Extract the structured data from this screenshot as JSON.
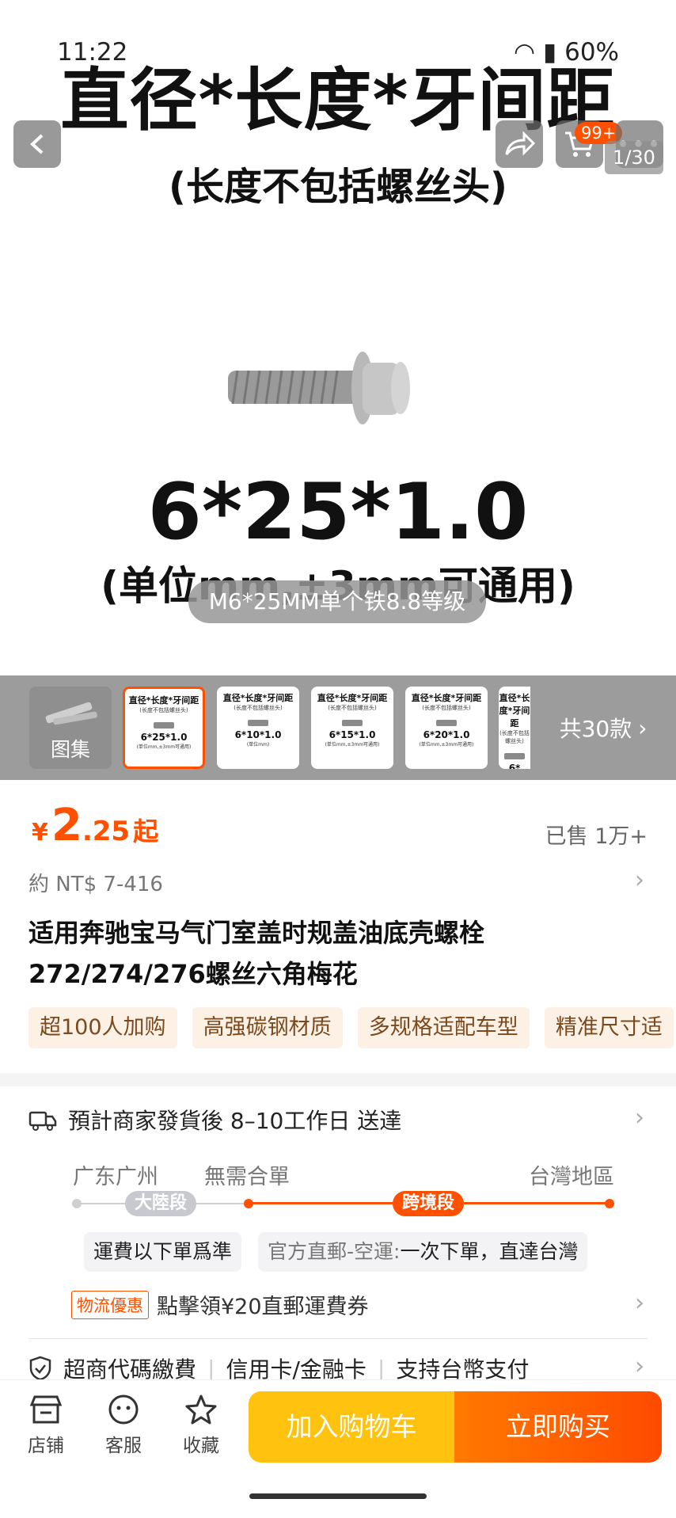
{
  "status_bar": {
    "time": "11:22",
    "battery": "60%"
  },
  "hero": {
    "title": "直径*长度*牙间距",
    "subtitle": "(长度不包括螺丝头)",
    "size": "6*25*1.0",
    "unit": "(单位mm,±3mm可通用)",
    "caption": "M6*25MM单个铁8.8等级",
    "cart_badge": "99+",
    "counter": "1/30"
  },
  "thumbnails": {
    "gallery_label": "图集",
    "title": "直径*长度*牙间距",
    "sub": "(长度不包括螺丝头)",
    "items": [
      {
        "value": "6*25*1.0",
        "unit": "(单位mm,±3mm可通用)"
      },
      {
        "value": "6*10*1.0",
        "unit": "(单位mm)"
      },
      {
        "value": "6*15*1.0",
        "unit": "(单位mm,±3mm可通用)"
      },
      {
        "value": "6*20*1.0",
        "unit": "(单位mm,±3mm可通用)"
      },
      {
        "value": "6*",
        "unit": ""
      }
    ],
    "more_label": "共30款"
  },
  "product": {
    "price_symbol": "¥",
    "price_int": "2",
    "price_dec": ".25",
    "price_suffix": "起",
    "sold": "已售 1万+",
    "approx": "約 NT$ 7-416",
    "title_line1": "适用奔驰宝马气门室盖时规盖油底壳螺栓",
    "title_line2": "272/274/276螺丝六角梅花",
    "tags": [
      "超100人加购",
      "高强碳钢材质",
      "多规格适配车型",
      "精准尺寸适"
    ]
  },
  "delivery": {
    "estimate": "預計商家發貨後 8–10工作日 送達",
    "origin": "广东广州",
    "consolidation": "無需合單",
    "destination": "台灣地區",
    "segment_mainland": "大陸段",
    "segment_cross": "跨境段",
    "note_left": "運費以下單爲準",
    "note_right_label": "官方直郵-空運:",
    "note_right_text": "一次下單，直達台灣",
    "promo_tag": "物流優惠",
    "promo_text": "點擊領¥20直郵運費券",
    "pay_1": "超商代碼繳費",
    "pay_2": "信用卡/金融卡",
    "pay_3": "支持台幣支付"
  },
  "bottom_bar": {
    "store": "店铺",
    "service": "客服",
    "favorite": "收藏",
    "add_cart": "加入购物车",
    "buy_now": "立即购买"
  },
  "colors": {
    "accent": "#ff5000",
    "cart_button": "#ffc20e"
  }
}
